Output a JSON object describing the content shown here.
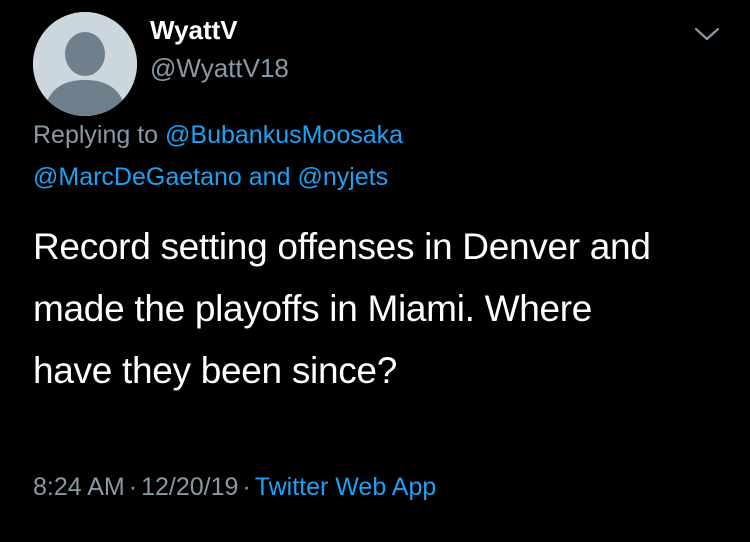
{
  "author": {
    "display_name": "WyattV",
    "handle": "@WyattV18",
    "avatar": "default-avatar-icon"
  },
  "reply": {
    "prefix": "Replying to",
    "mention_1": "@BubankusMoosaka",
    "mention_2": "@MarcDeGaetano",
    "conjunction": "and",
    "mention_3": "@nyjets"
  },
  "tweet": {
    "lines": [
      "Record setting offenses in Denver and",
      "made the playoffs in Miami. Where",
      "have they been since?"
    ]
  },
  "meta": {
    "time": "8:24 AM",
    "separator": "·",
    "date": "12/20/19",
    "source": "Twitter Web App"
  },
  "icons": {
    "menu": "chevron-down-icon"
  },
  "colors": {
    "background": "#000000",
    "text": "#ffffff",
    "muted": "#8899a6",
    "link": "#1da1f2",
    "avatar_bg": "#ccd6dd"
  }
}
